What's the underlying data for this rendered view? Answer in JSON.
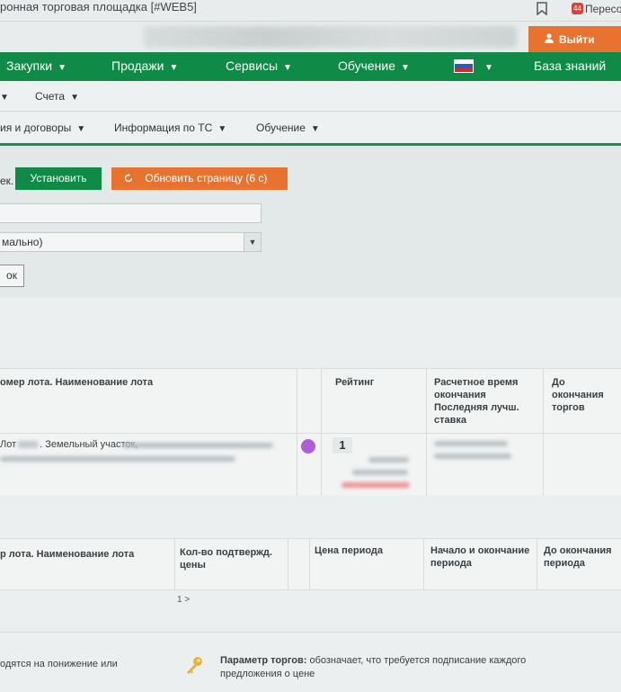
{
  "titlebar": {
    "title": "ронная торговая площадка [#WEB5]",
    "badge_count": "44",
    "badge_text": "Пересо"
  },
  "header": {
    "exit_label": "Выйти"
  },
  "green_nav": {
    "items": [
      "Закупки",
      "Продажи",
      "Сервисы",
      "Обучение"
    ],
    "knowledge_base": "База знаний"
  },
  "sub_nav_1": {
    "items": [
      "Счета"
    ]
  },
  "sub_nav_2": {
    "items": [
      "ия и договоры",
      "Информация по ТС",
      "Обучение"
    ]
  },
  "filters": {
    "label": "ек.",
    "install_button": "Установить",
    "refresh_button": "Обновить страницу (6 с)",
    "select_value": "мально)",
    "ok_button": "ок"
  },
  "table1": {
    "headers": {
      "lot": "омер лота. Наименование лота",
      "rating": "Рейтинг",
      "calc_time": "Расчетное время окончания Последняя лучш. ставка",
      "until_end": "До окончания торгов"
    },
    "rows": [
      {
        "lot_prefix": "Лот",
        "lot_name": ". Земельный участок,",
        "rating": "1",
        "status_color": "#b05ed6"
      }
    ]
  },
  "table2": {
    "headers": {
      "lot": "р лота. Наименование лота",
      "confirmed": "Кол-во подтвержд. цены",
      "period_price": "Цена периода",
      "period_start_end": "Начало и окончание периода",
      "until_period_end": "До окончания периода"
    }
  },
  "pager": {
    "text": "1 >"
  },
  "footer": {
    "left_text": "одятся на понижение или",
    "param_label": "Параметр торгов:",
    "param_text": " обозначает, что требуется подписание каждого предложения о цене"
  },
  "colors": {
    "primary_green": "#0f8a47",
    "accent_orange": "#e8722f",
    "status_purple": "#b05ed6"
  }
}
